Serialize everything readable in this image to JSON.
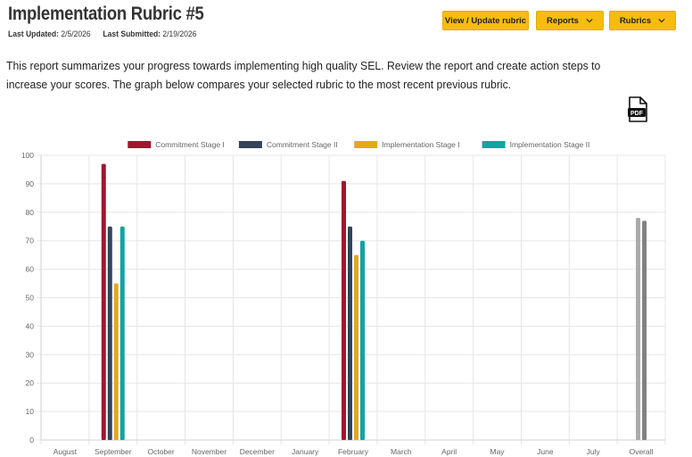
{
  "header": {
    "title": "Implementation Rubric #5",
    "last_updated_label": "Last Updated:",
    "last_updated_value": "2/5/2026",
    "last_submitted_label": "Last Submitted:",
    "last_submitted_value": "2/19/2026"
  },
  "toolbar": {
    "view_update_label": "View / Update rubric",
    "reports_label": "Reports",
    "rubrics_label": "Rubrics",
    "accent_color": "#f6bc0f"
  },
  "description": "This report summarizes your progress towards implementing high quality SEL. Review the report and create action steps to increase your scores. The graph below compares your selected rubric to the most recent previous rubric.",
  "pdf_icon": {
    "icon": "pdf-file-icon",
    "label": "PDF"
  },
  "chart_data": {
    "type": "bar",
    "categories": [
      "August",
      "September",
      "October",
      "November",
      "December",
      "January",
      "February",
      "March",
      "April",
      "May",
      "June",
      "July",
      "Overall"
    ],
    "ylim": [
      0,
      100
    ],
    "yticks": [
      0,
      10,
      20,
      30,
      40,
      50,
      60,
      70,
      80,
      90,
      100
    ],
    "grid": true,
    "legend_position": "top",
    "series": [
      {
        "name": "Commitment Stage I",
        "color": "#a3152f",
        "values": [
          null,
          97,
          null,
          null,
          null,
          null,
          91,
          null,
          null,
          null,
          null,
          null,
          null
        ]
      },
      {
        "name": "Commitment Stage II",
        "color": "#34435a",
        "values": [
          null,
          75,
          null,
          null,
          null,
          null,
          75,
          null,
          null,
          null,
          null,
          null,
          null
        ]
      },
      {
        "name": "Implementation Stage I",
        "color": "#e1a91f",
        "values": [
          null,
          55,
          null,
          null,
          null,
          null,
          65,
          null,
          null,
          null,
          null,
          null,
          null
        ]
      },
      {
        "name": "Implementation Stage II",
        "color": "#13a3a3",
        "values": [
          null,
          75,
          null,
          null,
          null,
          null,
          70,
          null,
          null,
          null,
          null,
          null,
          null
        ]
      }
    ],
    "overall": {
      "values": [
        78,
        77
      ],
      "colors": [
        "#aaaaaa",
        "#808080"
      ]
    }
  }
}
